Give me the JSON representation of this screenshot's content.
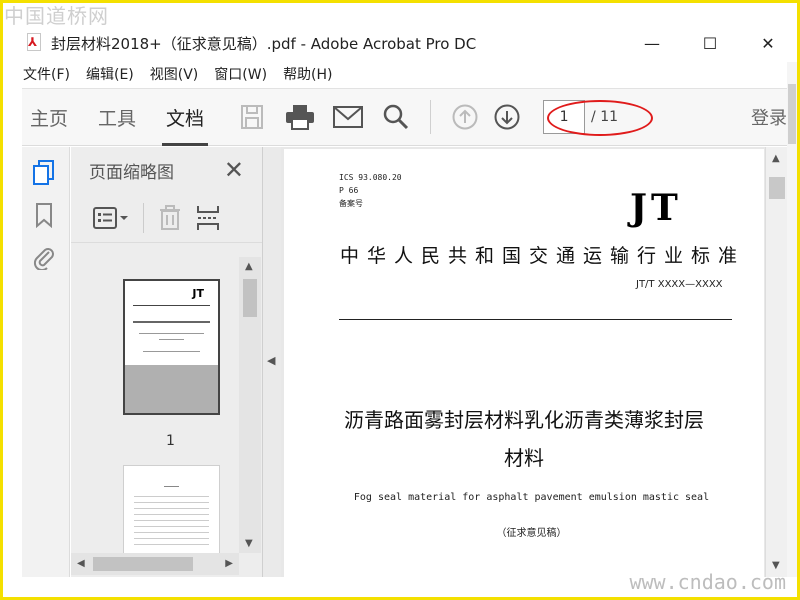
{
  "watermarks": {
    "top": "中国道桥网",
    "bottom": "www.cndao.com"
  },
  "window": {
    "title": "封层材料2018+（征求意见稿）.pdf - Adobe Acrobat Pro DC",
    "minimize": "—",
    "maximize": "☐",
    "close": "✕"
  },
  "menu": [
    "文件(F)",
    "编辑(E)",
    "视图(V)",
    "窗口(W)",
    "帮助(H)"
  ],
  "toolbar": {
    "tabs": [
      "主页",
      "工具",
      "文档"
    ],
    "active_tab": "文档",
    "current_page": "1",
    "total_pages": "/ 11",
    "login": "登录"
  },
  "thumbnail_panel": {
    "title": "页面缩略图",
    "close": "✕",
    "page_label": "1"
  },
  "document": {
    "ics": "ICS  93.080.20",
    "p": "P 66",
    "record": "备案号",
    "logo": "JT",
    "standard_title": "中华人民共和国交通运输行业标准",
    "code": "JT/T XXXX—XXXX",
    "title_line1": "沥青路面雾封层材料乳化沥青类薄浆封层",
    "title_line2": "材料",
    "english_title": "Fog seal material for asphalt pavement emulsion mastic seal",
    "draft": "（征求意见稿）"
  },
  "colors": {
    "frame": "#f4e000",
    "annotation_ellipse": "#e01b1b",
    "acrobat_red": "#d71920"
  }
}
